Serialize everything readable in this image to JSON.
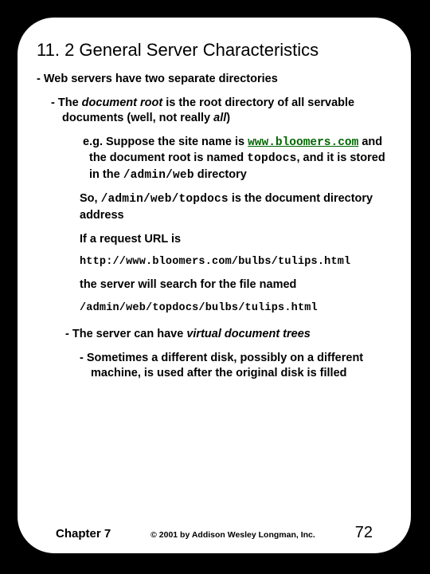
{
  "title": "11. 2 General Server Characteristics",
  "lines": {
    "p1": "- Web servers have two separate directories",
    "p2a": "- The ",
    "p2b": "document root",
    "p2c": " is the root directory of all servable documents (well, not really ",
    "p2d": "all",
    "p2e": ")",
    "p3a": "e.g. Suppose the site name is ",
    "p3b": "www.bloomers.com",
    "p3c": " and the document root is named ",
    "p3d": "topdocs",
    "p3e": ", and it is stored in the ",
    "p3f": "/admin/web",
    "p3g": " directory",
    "p4a": "So, ",
    "p4b": "/admin/web/topdocs",
    "p4c": " is the document directory address",
    "p5": "If a request URL is",
    "p6": "http://www.bloomers.com/bulbs/tulips.html",
    "p7": "the server will search for the file named",
    "p8": "/admin/web/topdocs/bulbs/tulips.html",
    "p9a": "- The server can have ",
    "p9b": "virtual document trees",
    "p10": "- Sometimes a different disk, possibly on a different machine, is used after the original disk is filled"
  },
  "footer": {
    "left": "Chapter 7",
    "center": "© 2001 by Addison Wesley Longman, Inc.",
    "right": "72"
  }
}
